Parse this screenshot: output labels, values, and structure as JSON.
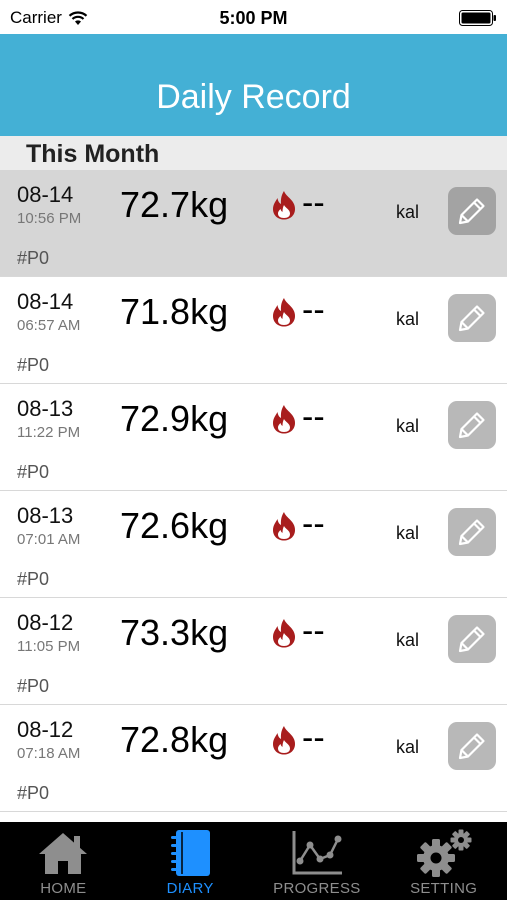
{
  "status_bar": {
    "carrier": "Carrier",
    "time": "5:00 PM"
  },
  "header": {
    "title": "Daily Record"
  },
  "section": {
    "title": "This Month"
  },
  "records": [
    {
      "date": "08-14",
      "time": "10:56 PM",
      "weight": "72.7kg",
      "calories": "--",
      "unit": "kal",
      "tag": "#P0",
      "selected": true
    },
    {
      "date": "08-14",
      "time": "06:57 AM",
      "weight": "71.8kg",
      "calories": "--",
      "unit": "kal",
      "tag": "#P0",
      "selected": false
    },
    {
      "date": "08-13",
      "time": "11:22 PM",
      "weight": "72.9kg",
      "calories": "--",
      "unit": "kal",
      "tag": "#P0",
      "selected": false
    },
    {
      "date": "08-13",
      "time": "07:01 AM",
      "weight": "72.6kg",
      "calories": "--",
      "unit": "kal",
      "tag": "#P0",
      "selected": false
    },
    {
      "date": "08-12",
      "time": "11:05 PM",
      "weight": "73.3kg",
      "calories": "--",
      "unit": "kal",
      "tag": "#P0",
      "selected": false
    },
    {
      "date": "08-12",
      "time": "07:18 AM",
      "weight": "72.8kg",
      "calories": "--",
      "unit": "kal",
      "tag": "#P0",
      "selected": false
    }
  ],
  "tabs": [
    {
      "label": "HOME",
      "icon": "home-icon",
      "active": false
    },
    {
      "label": "DIARY",
      "icon": "diary-icon",
      "active": true
    },
    {
      "label": "PROGRESS",
      "icon": "progress-chart-icon",
      "active": false
    },
    {
      "label": "SETTING",
      "icon": "gear-icon",
      "active": false
    }
  ],
  "colors": {
    "header": "#44b0d5",
    "active_tab": "#1e90ff",
    "flame": "#a81d1d",
    "tabbar": "#000000"
  }
}
